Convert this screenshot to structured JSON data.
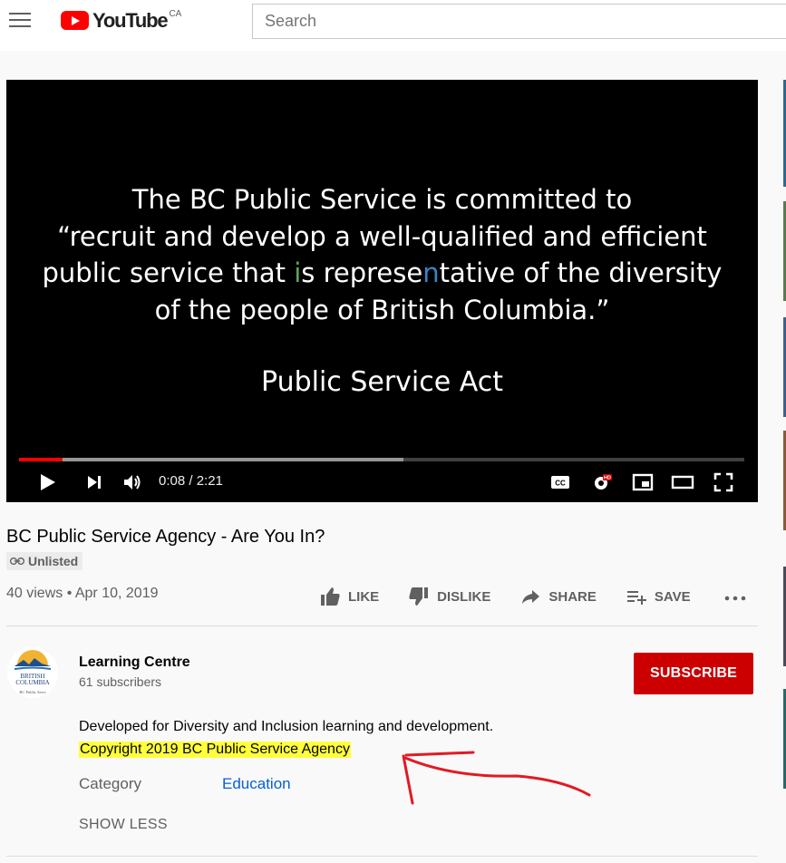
{
  "header": {
    "logo_text": "YouTube",
    "logo_region": "CA",
    "search_placeholder": "Search"
  },
  "player": {
    "quote_lines": [
      "The BC Public Service is committed to",
      "“recruit and develop a well-qualified and efficient",
      "public service that is representative of the diversity",
      "of the people of British Columbia.”"
    ],
    "attribution": "Public Service Act",
    "time": "0:08 / 2:21",
    "progress_played_pct": 6,
    "progress_buffered_pct": 53
  },
  "video": {
    "title": "BC Public Service Agency - Are You In?",
    "badge": "Unlisted",
    "meta": "40 views • Apr 10, 2019",
    "actions": {
      "like": "LIKE",
      "dislike": "DISLIKE",
      "share": "SHARE",
      "save": "SAVE"
    }
  },
  "channel": {
    "name": "Learning Centre",
    "subscribers": "61 subscribers",
    "subscribe_label": "SUBSCRIBE",
    "avatar_text_1": "BRITISH",
    "avatar_text_2": "COLUMBIA",
    "avatar_text_3": "BC Public Servi"
  },
  "description": {
    "line1": "Developed for Diversity and Inclusion learning and development.",
    "line2": "Copyright 2019 BC Public Service Agency",
    "category_label": "Category",
    "category_value": "Education",
    "show_less": "SHOW LESS"
  },
  "colors": {
    "brand_red": "#ff0000",
    "subscribe_red": "#cc0000",
    "link_blue": "#065fd4",
    "highlight_yellow": "#ffff3b",
    "annotation_red": "#e01b24"
  }
}
